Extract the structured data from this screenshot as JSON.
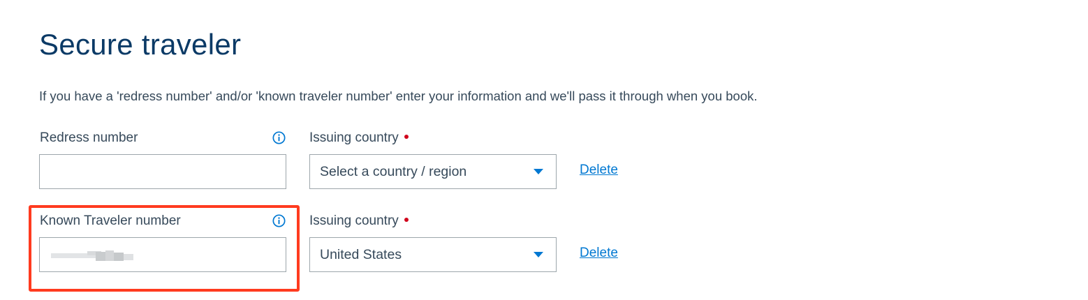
{
  "page": {
    "title": "Secure traveler",
    "intro": "If you have a 'redress number' and/or 'known traveler number' enter your information and we'll pass it through when you book."
  },
  "redress": {
    "label": "Redress number",
    "value": "",
    "country_label": "Issuing country",
    "country_value": "Select a country / region",
    "delete_label": "Delete"
  },
  "known_traveler": {
    "label": "Known Traveler number",
    "value_masked": true,
    "country_label": "Issuing country",
    "country_value": "United States",
    "delete_label": "Delete"
  },
  "icons": {
    "info": "info-circle-icon",
    "dropdown": "caret-down-icon",
    "required": "required-dot-icon"
  },
  "colors": {
    "title": "#0b3a66",
    "text": "#36495a",
    "accent": "#0078d2",
    "required": "#d0021b",
    "highlight": "#ff3b1f",
    "border": "#9da6ab"
  }
}
